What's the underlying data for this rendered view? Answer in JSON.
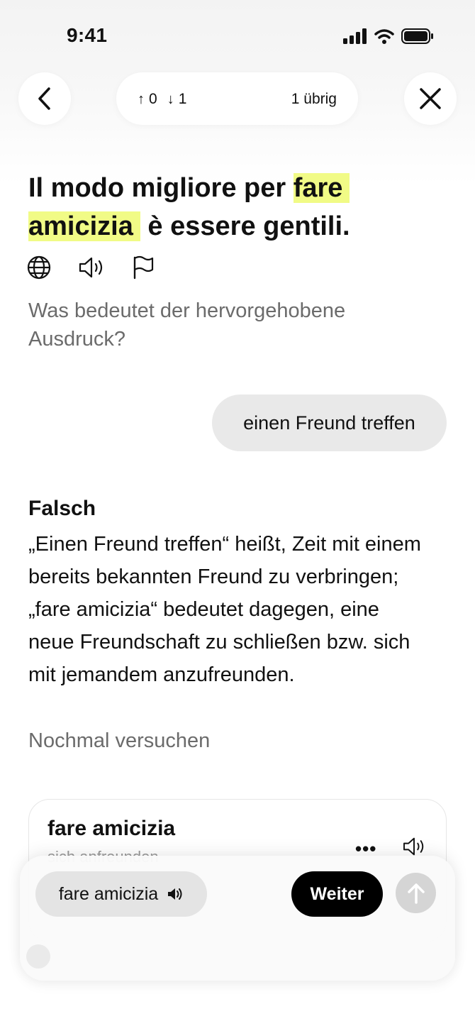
{
  "status_bar": {
    "time": "9:41"
  },
  "top_bar": {
    "up_count": "0",
    "down_count": "1",
    "remaining": "1 übrig"
  },
  "sentence": {
    "before": "Il modo migliore per ",
    "highlight_1": "fare",
    "highlight_2": "amicizia",
    "after": " è essere gentili."
  },
  "question": "Was bedeutet der hervorgehobene Ausdruck?",
  "user_answer": "einen Freund treffen",
  "feedback": {
    "verdict": "Falsch",
    "explanation": "„Einen Freund treffen“ heißt, Zeit mit einem bereits bekannten Freund zu verbringen; „fare amicizia“ bedeutet dagegen, eine neue Freundschaft zu schließen bzw. sich mit jemandem anzufreunden.",
    "retry": "Nochmal versuchen"
  },
  "vocab_card": {
    "term": "fare amicizia",
    "subtitle": "sich anfreunden"
  },
  "composer": {
    "chip_label": "fare amicizia",
    "next_label": "Weiter"
  },
  "icons": {
    "back": "chevron-left-icon",
    "close": "close-icon",
    "globe": "globe-icon",
    "speaker": "speaker-icon",
    "flag": "flag-icon",
    "more": "more-icon",
    "send": "arrow-up-icon"
  },
  "colors": {
    "highlight": "#f1fb86",
    "primary_button": "#000000",
    "bubble": "#e9e9e9",
    "muted_text": "#6b6b6b"
  }
}
